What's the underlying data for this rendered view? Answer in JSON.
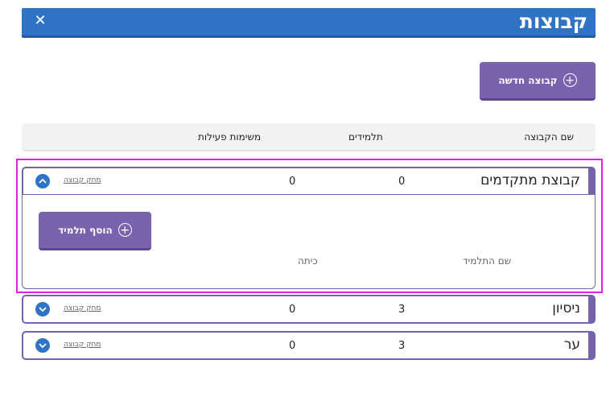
{
  "window": {
    "title": "קבוצות",
    "close_glyph": "✕"
  },
  "toolbar": {
    "new_group_label": "קבוצה חדשה",
    "new_group_icon": "plus-circle-icon"
  },
  "table": {
    "headers": {
      "group_name": "שם הקבוצה",
      "students": "תלמידים",
      "tasks": "משימות פעילות"
    },
    "delete_label": "מחק קבוצה",
    "rows": [
      {
        "name": "קבוצת מתקדמים",
        "students": "0",
        "tasks": "0",
        "expanded": true
      },
      {
        "name": "ניסיון",
        "students": "3",
        "tasks": "0",
        "expanded": false
      },
      {
        "name": "ער",
        "students": "3",
        "tasks": "0",
        "expanded": false
      }
    ]
  },
  "expanded": {
    "add_student_label": "הוסף תלמיד",
    "student_name_header": "שם התלמיד",
    "class_header": "כיתה"
  },
  "colors": {
    "title_bar": "#2f74c4",
    "button": "#7b62ae",
    "row_border": "#7563ac",
    "highlight": "#e11ee9"
  }
}
